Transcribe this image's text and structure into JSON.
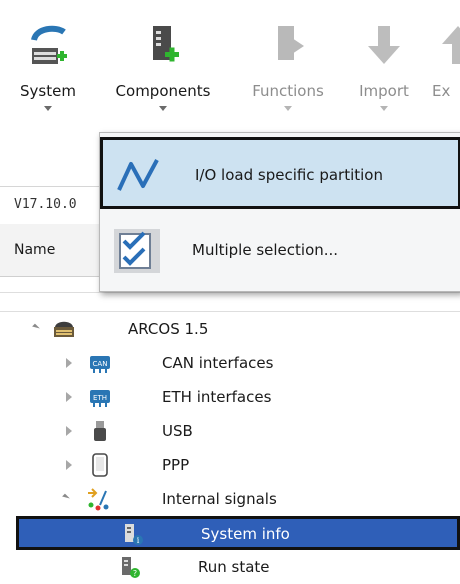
{
  "toolbar": {
    "buttons": [
      {
        "label": "System",
        "icon": "system-add-icon",
        "enabled": true
      },
      {
        "label": "Components",
        "icon": "components-add-icon",
        "enabled": true
      },
      {
        "label": "Functions",
        "icon": "functions-icon",
        "enabled": false
      },
      {
        "label": "Import",
        "icon": "import-icon",
        "enabled": false
      },
      {
        "label": "Ex",
        "icon": "export-icon",
        "enabled": false
      }
    ]
  },
  "panel": {
    "version": "V17.10.0",
    "column_name": "Name"
  },
  "dropdown": {
    "items": [
      {
        "label": "I/O load specific partition",
        "icon": "io-load-wave-icon",
        "highlighted": true
      },
      {
        "label": "Multiple selection...",
        "icon": "multiple-selection-icon",
        "highlighted": false
      }
    ]
  },
  "tree": {
    "items": [
      {
        "label": "ARCOS 1.5",
        "icon": "device-icon",
        "expanded": true
      },
      {
        "label": "CAN interfaces",
        "icon": "can-interface-icon",
        "expanded": false
      },
      {
        "label": "ETH interfaces",
        "icon": "eth-interface-icon",
        "expanded": false
      },
      {
        "label": "USB",
        "icon": "usb-icon",
        "expanded": false
      },
      {
        "label": "PPP",
        "icon": "ppp-icon",
        "expanded": false
      },
      {
        "label": "Internal signals",
        "icon": "internal-signals-icon",
        "expanded": true
      },
      {
        "label": "System info",
        "icon": "system-info-icon",
        "selected": true
      },
      {
        "label": "Run state",
        "icon": "run-state-icon"
      }
    ]
  },
  "colors": {
    "selection": "#2f5fb8",
    "menu_highlight": "#cde2f1",
    "accent_green": "#2fb52f",
    "icon_blue": "#2a76b4"
  }
}
